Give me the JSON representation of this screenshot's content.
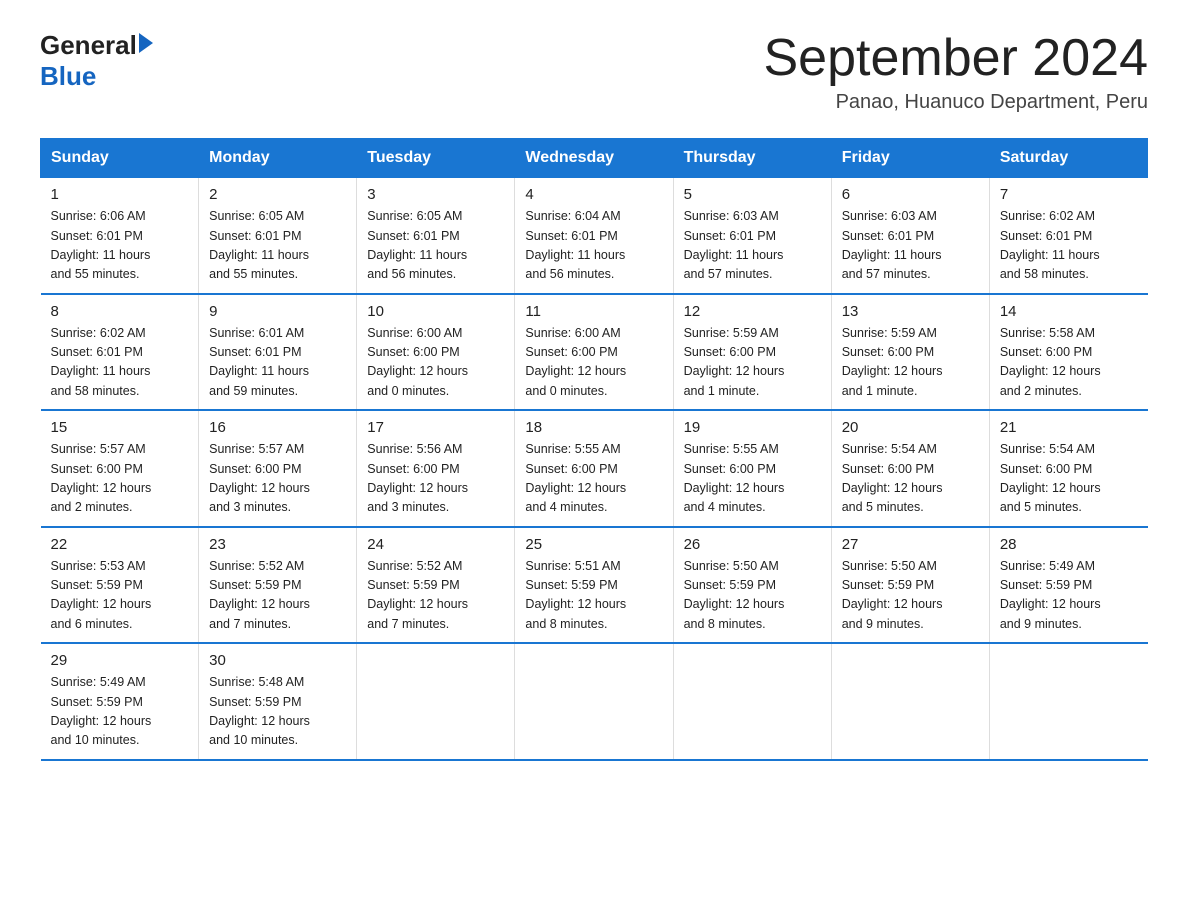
{
  "header": {
    "logo_general": "General",
    "logo_triangle": "",
    "logo_blue": "Blue",
    "month_year": "September 2024",
    "location": "Panao, Huanuco Department, Peru"
  },
  "days_of_week": [
    "Sunday",
    "Monday",
    "Tuesday",
    "Wednesday",
    "Thursday",
    "Friday",
    "Saturday"
  ],
  "weeks": [
    [
      {
        "day": "1",
        "info": "Sunrise: 6:06 AM\nSunset: 6:01 PM\nDaylight: 11 hours\nand 55 minutes."
      },
      {
        "day": "2",
        "info": "Sunrise: 6:05 AM\nSunset: 6:01 PM\nDaylight: 11 hours\nand 55 minutes."
      },
      {
        "day": "3",
        "info": "Sunrise: 6:05 AM\nSunset: 6:01 PM\nDaylight: 11 hours\nand 56 minutes."
      },
      {
        "day": "4",
        "info": "Sunrise: 6:04 AM\nSunset: 6:01 PM\nDaylight: 11 hours\nand 56 minutes."
      },
      {
        "day": "5",
        "info": "Sunrise: 6:03 AM\nSunset: 6:01 PM\nDaylight: 11 hours\nand 57 minutes."
      },
      {
        "day": "6",
        "info": "Sunrise: 6:03 AM\nSunset: 6:01 PM\nDaylight: 11 hours\nand 57 minutes."
      },
      {
        "day": "7",
        "info": "Sunrise: 6:02 AM\nSunset: 6:01 PM\nDaylight: 11 hours\nand 58 minutes."
      }
    ],
    [
      {
        "day": "8",
        "info": "Sunrise: 6:02 AM\nSunset: 6:01 PM\nDaylight: 11 hours\nand 58 minutes."
      },
      {
        "day": "9",
        "info": "Sunrise: 6:01 AM\nSunset: 6:01 PM\nDaylight: 11 hours\nand 59 minutes."
      },
      {
        "day": "10",
        "info": "Sunrise: 6:00 AM\nSunset: 6:00 PM\nDaylight: 12 hours\nand 0 minutes."
      },
      {
        "day": "11",
        "info": "Sunrise: 6:00 AM\nSunset: 6:00 PM\nDaylight: 12 hours\nand 0 minutes."
      },
      {
        "day": "12",
        "info": "Sunrise: 5:59 AM\nSunset: 6:00 PM\nDaylight: 12 hours\nand 1 minute."
      },
      {
        "day": "13",
        "info": "Sunrise: 5:59 AM\nSunset: 6:00 PM\nDaylight: 12 hours\nand 1 minute."
      },
      {
        "day": "14",
        "info": "Sunrise: 5:58 AM\nSunset: 6:00 PM\nDaylight: 12 hours\nand 2 minutes."
      }
    ],
    [
      {
        "day": "15",
        "info": "Sunrise: 5:57 AM\nSunset: 6:00 PM\nDaylight: 12 hours\nand 2 minutes."
      },
      {
        "day": "16",
        "info": "Sunrise: 5:57 AM\nSunset: 6:00 PM\nDaylight: 12 hours\nand 3 minutes."
      },
      {
        "day": "17",
        "info": "Sunrise: 5:56 AM\nSunset: 6:00 PM\nDaylight: 12 hours\nand 3 minutes."
      },
      {
        "day": "18",
        "info": "Sunrise: 5:55 AM\nSunset: 6:00 PM\nDaylight: 12 hours\nand 4 minutes."
      },
      {
        "day": "19",
        "info": "Sunrise: 5:55 AM\nSunset: 6:00 PM\nDaylight: 12 hours\nand 4 minutes."
      },
      {
        "day": "20",
        "info": "Sunrise: 5:54 AM\nSunset: 6:00 PM\nDaylight: 12 hours\nand 5 minutes."
      },
      {
        "day": "21",
        "info": "Sunrise: 5:54 AM\nSunset: 6:00 PM\nDaylight: 12 hours\nand 5 minutes."
      }
    ],
    [
      {
        "day": "22",
        "info": "Sunrise: 5:53 AM\nSunset: 5:59 PM\nDaylight: 12 hours\nand 6 minutes."
      },
      {
        "day": "23",
        "info": "Sunrise: 5:52 AM\nSunset: 5:59 PM\nDaylight: 12 hours\nand 7 minutes."
      },
      {
        "day": "24",
        "info": "Sunrise: 5:52 AM\nSunset: 5:59 PM\nDaylight: 12 hours\nand 7 minutes."
      },
      {
        "day": "25",
        "info": "Sunrise: 5:51 AM\nSunset: 5:59 PM\nDaylight: 12 hours\nand 8 minutes."
      },
      {
        "day": "26",
        "info": "Sunrise: 5:50 AM\nSunset: 5:59 PM\nDaylight: 12 hours\nand 8 minutes."
      },
      {
        "day": "27",
        "info": "Sunrise: 5:50 AM\nSunset: 5:59 PM\nDaylight: 12 hours\nand 9 minutes."
      },
      {
        "day": "28",
        "info": "Sunrise: 5:49 AM\nSunset: 5:59 PM\nDaylight: 12 hours\nand 9 minutes."
      }
    ],
    [
      {
        "day": "29",
        "info": "Sunrise: 5:49 AM\nSunset: 5:59 PM\nDaylight: 12 hours\nand 10 minutes."
      },
      {
        "day": "30",
        "info": "Sunrise: 5:48 AM\nSunset: 5:59 PM\nDaylight: 12 hours\nand 10 minutes."
      },
      {
        "day": "",
        "info": ""
      },
      {
        "day": "",
        "info": ""
      },
      {
        "day": "",
        "info": ""
      },
      {
        "day": "",
        "info": ""
      },
      {
        "day": "",
        "info": ""
      }
    ]
  ]
}
